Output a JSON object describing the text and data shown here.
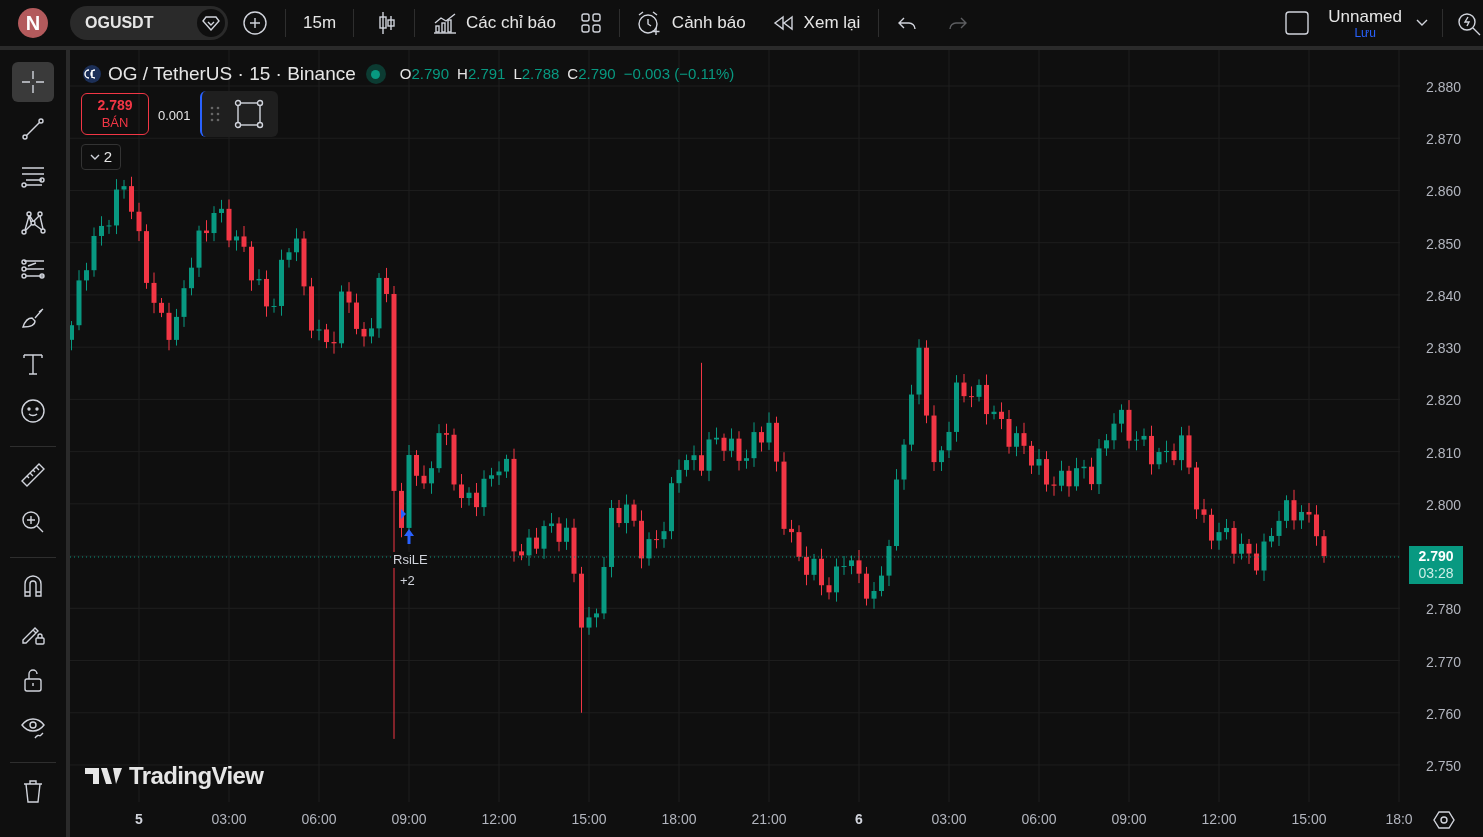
{
  "top_bar": {
    "avatar": "N",
    "symbol": "OGUSDT",
    "interval": "15m",
    "indicators_label": "Các chỉ báo",
    "alerts_label": "Cảnh báo",
    "replay_label": "Xem lại",
    "redo_disabled": true,
    "layout_name": "Unnamed",
    "save_label": "Lưu"
  },
  "left_toolbar": {
    "tools": [
      {
        "selected": true
      },
      {
        "selected": false
      },
      {
        "selected": false
      },
      {
        "selected": false
      },
      {
        "selected": false
      },
      {
        "selected": false
      },
      {
        "selected": false
      },
      {
        "selected": false
      },
      {
        "selected": false
      },
      {
        "selected": false
      },
      {
        "selected": false
      },
      {
        "selected": false
      },
      {
        "selected": false
      },
      {
        "selected": false
      },
      {
        "selected": false
      }
    ]
  },
  "legend": {
    "title": "OG / TetherUS · 15 · Binance",
    "values": [
      {
        "label": "O",
        "value": "2.790"
      },
      {
        "label": "H",
        "value": "2.791"
      },
      {
        "label": "L",
        "value": "2.788"
      },
      {
        "label": "C",
        "value": "2.790"
      }
    ],
    "change": "−0.003 (−0.11%)"
  },
  "trade": {
    "price": "2.789",
    "side": "BÁN",
    "quantity": "0.001"
  },
  "indicators_toggle": "2",
  "signal": {
    "label": "RsiLE",
    "extra": "+2"
  },
  "brand": "TradingView",
  "price_axis": {
    "labels": [
      {
        "kind": "tick",
        "text": "2.880"
      },
      {
        "kind": "tick",
        "text": "2.870"
      },
      {
        "kind": "tick",
        "text": "2.860"
      },
      {
        "kind": "tick",
        "text": "2.850"
      },
      {
        "kind": "tick",
        "text": "2.840"
      },
      {
        "kind": "tick",
        "text": "2.830"
      },
      {
        "kind": "tick",
        "text": "2.820"
      },
      {
        "kind": "tick",
        "text": "2.810"
      },
      {
        "kind": "tick",
        "text": "2.800"
      },
      {
        "kind": "last",
        "price": "2.790",
        "countdown": "03:28"
      },
      {
        "kind": "tick",
        "text": "2.780"
      },
      {
        "kind": "tick",
        "text": "2.770"
      },
      {
        "kind": "tick",
        "text": "2.760"
      },
      {
        "kind": "tick",
        "text": "2.750"
      }
    ]
  },
  "time_axis": {
    "ticks": [
      {
        "kind": "day",
        "text": "5"
      },
      {
        "kind": "time",
        "text": "03:00"
      },
      {
        "kind": "time",
        "text": "06:00"
      },
      {
        "kind": "time",
        "text": "09:00"
      },
      {
        "kind": "time",
        "text": "12:00"
      },
      {
        "kind": "time",
        "text": "15:00"
      },
      {
        "kind": "time",
        "text": "18:00"
      },
      {
        "kind": "time",
        "text": "21:00"
      },
      {
        "kind": "day",
        "text": "6"
      },
      {
        "kind": "time",
        "text": "03:00"
      },
      {
        "kind": "time",
        "text": "06:00"
      },
      {
        "kind": "time",
        "text": "09:00"
      },
      {
        "kind": "time",
        "text": "12:00"
      },
      {
        "kind": "time",
        "text": "15:00"
      },
      {
        "kind": "time",
        "text": "18:0"
      }
    ]
  }
}
